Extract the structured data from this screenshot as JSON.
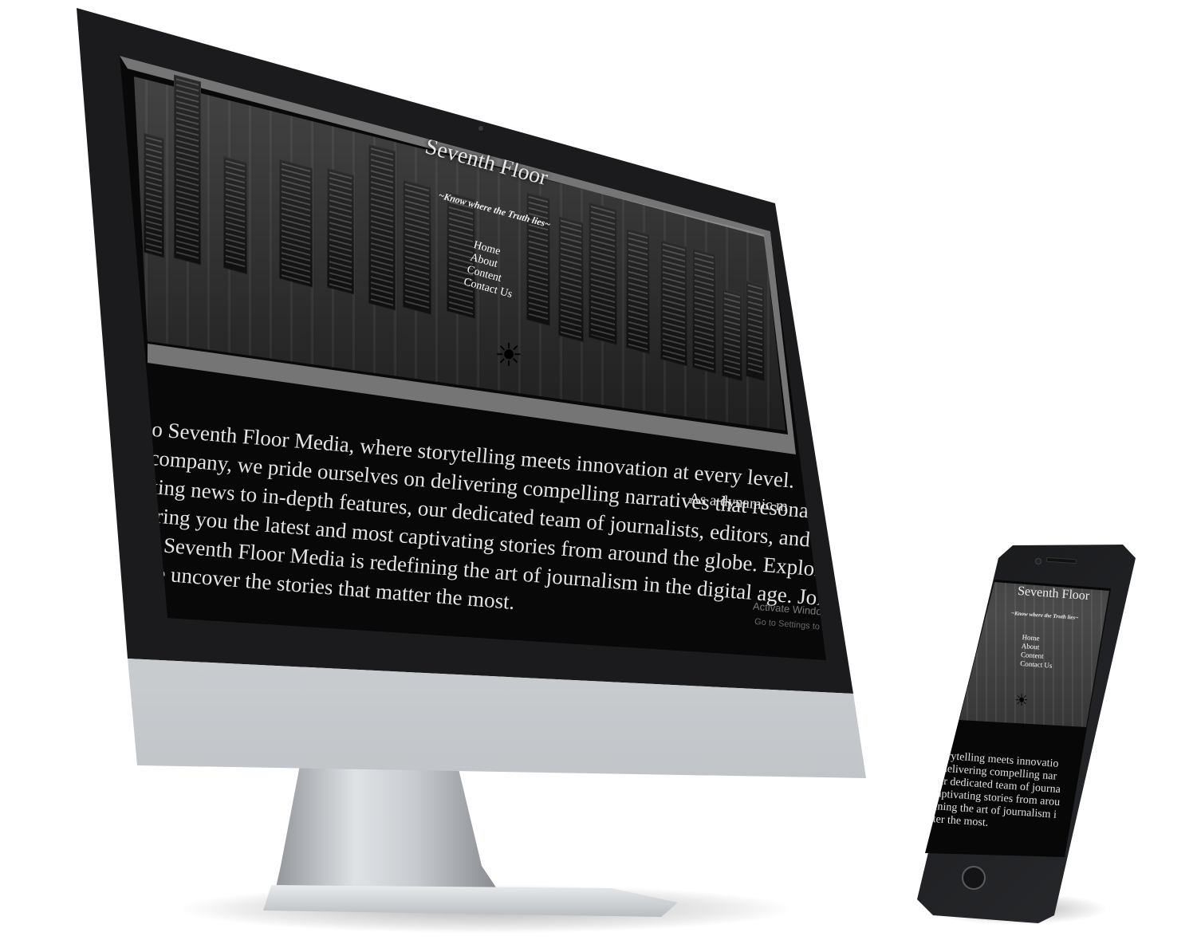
{
  "desktop": {
    "site_title": "Seventh Floor",
    "tagline": "~Know where the Truth lies~",
    "nav": [
      "Home",
      "About",
      "Content",
      "Contact Us"
    ],
    "body_lines": [
      "o Seventh Floor Media, where storytelling meets innovation at every level.",
      "company, we pride ourselves on delivering compelling narratives that resonate with our r",
      "king news to in-depth features, our dedicated team of journalists, editors, and creatives wor",
      "bring you the latest and most captivating stories from around the globe. Explore our webs",
      "w Seventh Floor Media is redefining the art of journalism in the digital age. Join us on thi",
      "we uncover the stories that matter the most."
    ],
    "overlay_fragment": "As a dynamic m",
    "activation_watermark": "Activate Windo",
    "activation_hint": "Go to Settings to acti"
  },
  "phone": {
    "site_title": "Seventh Floor",
    "tagline": "~Know where the Truth lies~",
    "nav": [
      "Home",
      "About",
      "Content",
      "Contact Us"
    ],
    "body_lines": [
      "storytelling meets innovatio",
      "n delivering compelling nar",
      "our dedicated team of journa",
      "captivating stories from arou",
      "fining the art of journalism i",
      "tter the most."
    ]
  },
  "icons": {
    "logo": "sun-icon"
  }
}
